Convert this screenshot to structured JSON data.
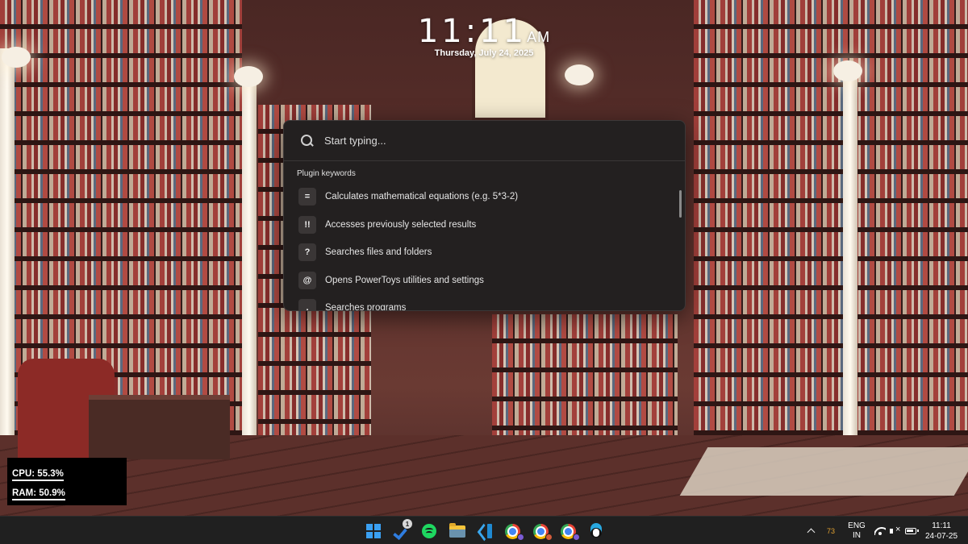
{
  "clock": {
    "time": "11:11",
    "ampm": "AM",
    "date": "Thursday, July 24, 2025"
  },
  "run": {
    "placeholder": "Start typing...",
    "section_title": "Plugin keywords",
    "items": [
      {
        "key": "=",
        "description": "Calculates mathematical equations (e.g. 5*3-2)"
      },
      {
        "key": "!!",
        "description": "Accesses previously selected results"
      },
      {
        "key": "?",
        "description": "Searches files and folders"
      },
      {
        "key": "@",
        "description": "Opens PowerToys utilities and settings"
      },
      {
        "key": ".",
        "description": "Searches programs"
      }
    ]
  },
  "sysmon": {
    "cpu": "CPU: 55.3%",
    "ram": "RAM: 50.9%"
  },
  "taskbar": {
    "apps": [
      {
        "name": "start",
        "icon": "windows-logo-icon"
      },
      {
        "name": "microsoft-todo",
        "icon": "todo-check-icon",
        "badge": "1"
      },
      {
        "name": "spotify",
        "icon": "spotify-icon"
      },
      {
        "name": "file-explorer",
        "icon": "folder-icon"
      },
      {
        "name": "vs-code",
        "icon": "vscode-icon"
      },
      {
        "name": "chrome-profile-1",
        "icon": "chrome-icon"
      },
      {
        "name": "chrome-profile-2",
        "icon": "chrome-icon"
      },
      {
        "name": "chrome-profile-3",
        "icon": "chrome-icon"
      },
      {
        "name": "penguin-app",
        "icon": "penguin-icon"
      }
    ],
    "tray": {
      "temperature": "73",
      "lang_line1": "ENG",
      "lang_line2": "IN",
      "time": "11:11",
      "date": "24-07-25"
    }
  },
  "colors": {
    "panel_bg": "#232020",
    "taskbar_bg": "#202020",
    "accent_windows": "#3aa0f2",
    "temperature": "#e0a030"
  }
}
